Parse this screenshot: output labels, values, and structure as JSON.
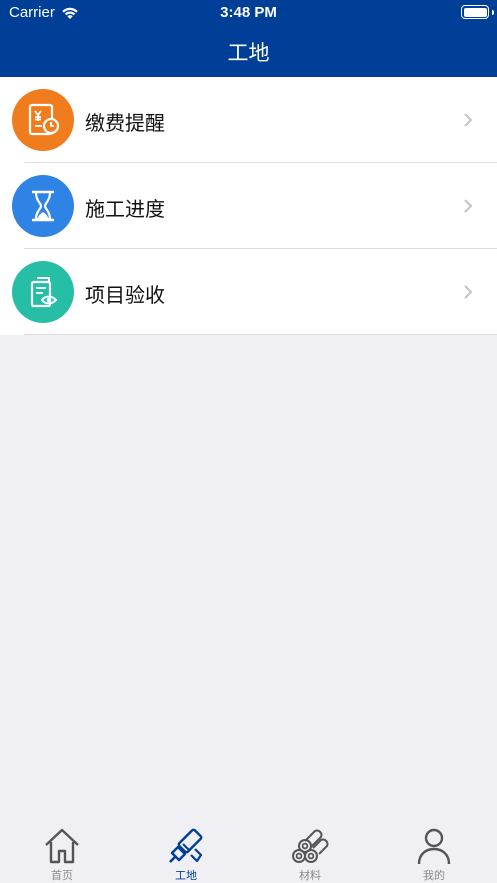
{
  "status_bar": {
    "carrier": "Carrier",
    "time": "3:48 PM"
  },
  "nav": {
    "title": "工地"
  },
  "menu": {
    "items": [
      {
        "label": "缴费提醒",
        "icon": "payment-reminder-icon",
        "color": "#f07c1e"
      },
      {
        "label": "施工进度",
        "icon": "hourglass-icon",
        "color": "#2f83e4"
      },
      {
        "label": "项目验收",
        "icon": "document-inspect-icon",
        "color": "#26bfa6"
      }
    ]
  },
  "tabbar": {
    "tabs": [
      {
        "label": "首页",
        "icon": "home-icon",
        "active": false
      },
      {
        "label": "工地",
        "icon": "roller-icon",
        "active": true
      },
      {
        "label": "材料",
        "icon": "materials-icon",
        "active": false
      },
      {
        "label": "我的",
        "icon": "person-icon",
        "active": false
      }
    ]
  },
  "colors": {
    "brand": "#003f98",
    "tab_inactive": "#8a8a8a",
    "background": "#efeff4"
  }
}
